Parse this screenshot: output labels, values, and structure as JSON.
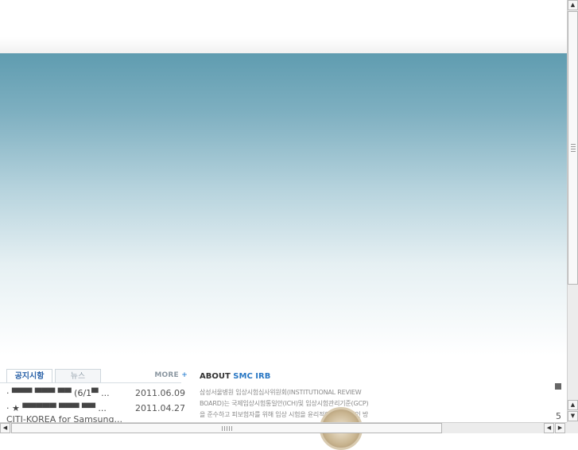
{
  "notice_tabs": {
    "active_label": "공지시항",
    "inactive_label": "뉴스",
    "more_label": "MORE",
    "more_plus": "+"
  },
  "notices": [
    {
      "title": "· ▀▀▀ ▀▀▀ ▀▀ (6/1▀ ...",
      "date": "2011.06.09"
    },
    {
      "title": "· ★ ▀▀▀▀▀ ▀▀▀ ▀▀ ...",
      "date": "2011.04.27"
    }
  ],
  "notice_extra": "CITI-KOREA for Samsung...",
  "about": {
    "title_prefix": "ABOUT",
    "title_highlight": "SMC IRB",
    "text": "삼성서울병원 임상시험심사위원회(INSTITUTIONAL REVIEW BOARD)는 국제임상시험통일안(ICH)및 임상시험관리기준(GCP)을 준수하고 피보험자를 위해 임상 시험을 윤리적이고 과학적인 방법으로 심사"
  },
  "page_number": "5",
  "scrollbars": {
    "up": "▲",
    "down": "▼",
    "left": "◀",
    "right": "▶"
  }
}
